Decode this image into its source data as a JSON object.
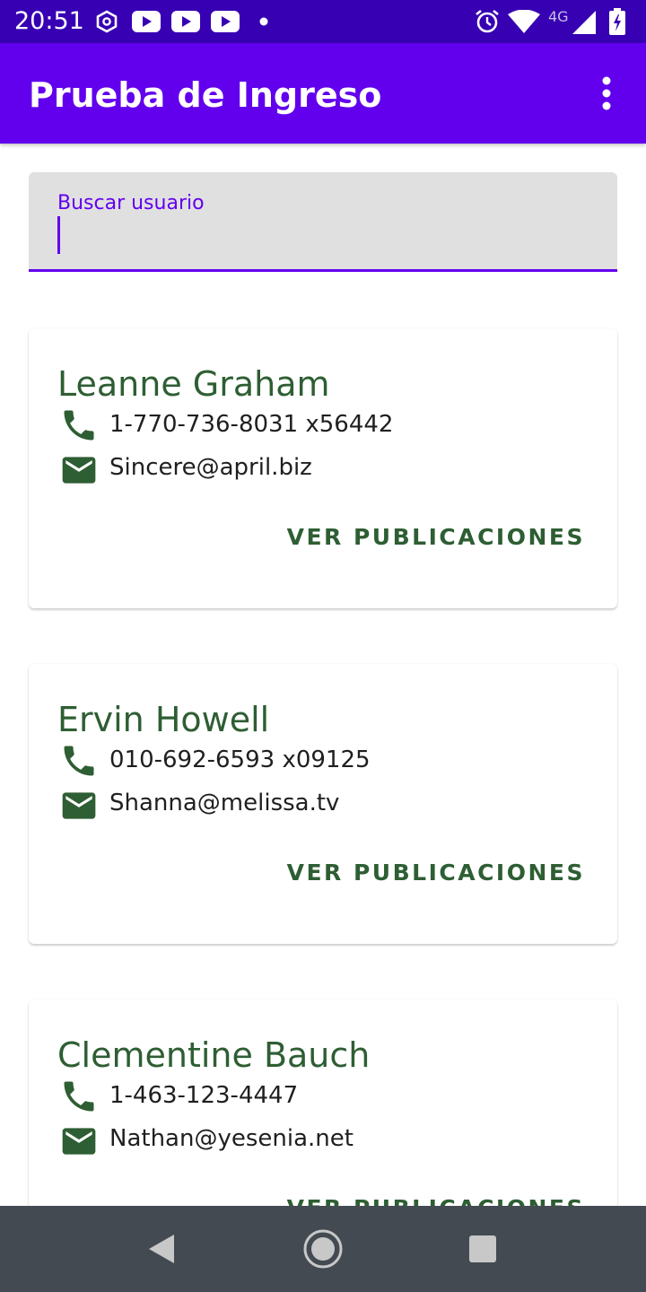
{
  "status_bar": {
    "time": "20:51",
    "network": "4G",
    "icons": [
      "hexagon-settings-icon",
      "youtube-icon",
      "youtube-icon",
      "youtube-icon",
      "dot-icon",
      "alarm-icon",
      "wifi-icon",
      "signal-icon",
      "battery-icon"
    ]
  },
  "app_bar": {
    "title": "Prueba de Ingreso",
    "menu_icon": "more-vert-icon",
    "background": "#6200ee",
    "status_background": "#3700b3"
  },
  "search": {
    "label": "Buscar usuario",
    "value": ""
  },
  "users": [
    {
      "name": "Leanne Graham",
      "phone": "1-770-736-8031 x56442",
      "email": "Sincere@april.biz",
      "action": "VER PUBLICACIONES"
    },
    {
      "name": "Ervin Howell",
      "phone": "010-692-6593 x09125",
      "email": "Shanna@melissa.tv",
      "action": "VER PUBLICACIONES"
    },
    {
      "name": "Clementine Bauch",
      "phone": "1-463-123-4447",
      "email": "Nathan@yesenia.net",
      "action": "VER PUBLICACIONES"
    }
  ],
  "colors": {
    "accent": "#6200ee",
    "name_green": "#2e5e33",
    "nav_bar": "#434a52"
  },
  "nav_bar": {
    "buttons": [
      "back-icon",
      "home-icon",
      "recents-icon"
    ]
  }
}
